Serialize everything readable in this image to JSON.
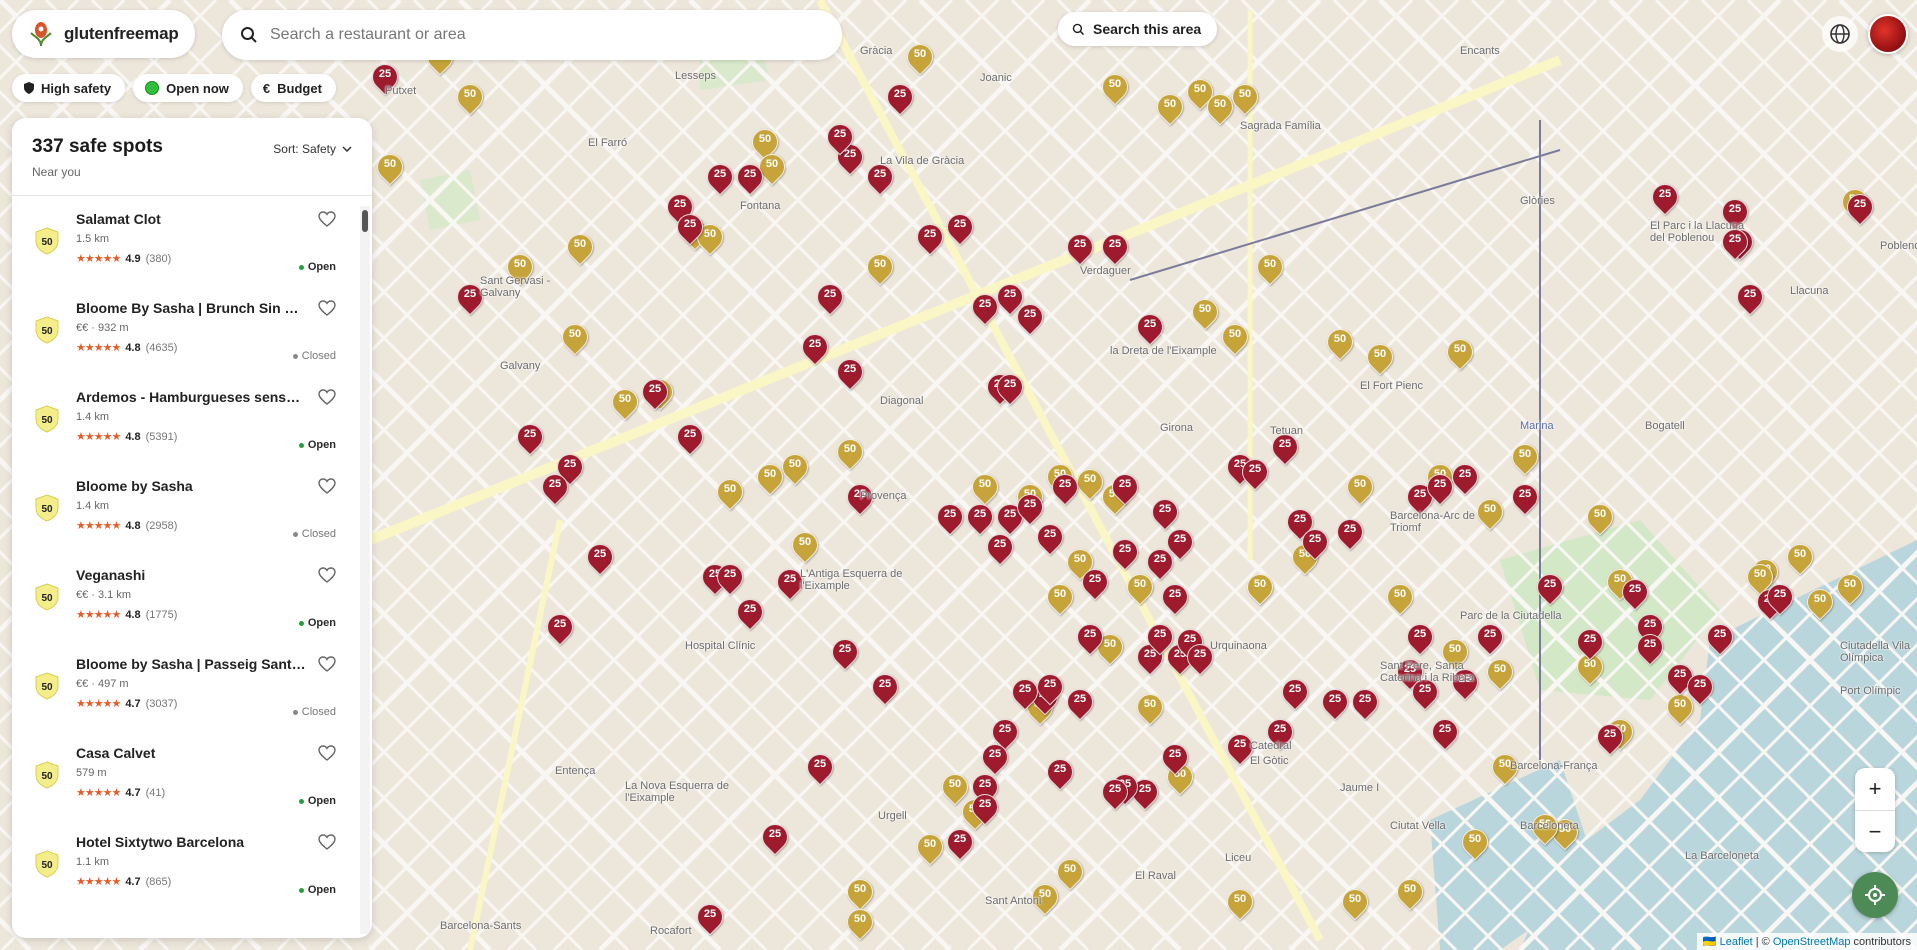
{
  "brand": {
    "name": "glutenfreemap"
  },
  "search": {
    "placeholder": "Search a restaurant or area"
  },
  "search_area": {
    "label": "Search this area"
  },
  "chips": [
    {
      "label": "High safety",
      "icon": "shield-icon"
    },
    {
      "label": "Open now",
      "icon": "green-dot-icon"
    },
    {
      "label": "Budget",
      "icon": "euro-icon",
      "prefix": "€"
    }
  ],
  "panel": {
    "title": "337 safe spots",
    "subtitle": "Near you",
    "sort_label": "Sort: Safety"
  },
  "restaurants": [
    {
      "badge": "50",
      "name": "Salamat Clot",
      "meta": "1.5 km",
      "rating": "4.9",
      "count": "(380)",
      "status": "Open"
    },
    {
      "badge": "50",
      "name": "Bloome By Sasha | Brunch Sin Gluten",
      "meta": "€€ · 932 m",
      "rating": "4.8",
      "count": "(4635)",
      "status": "Closed"
    },
    {
      "badge": "50",
      "name": "Ardemos - Hamburgueses sense gluten",
      "meta": "1.4 km",
      "rating": "4.8",
      "count": "(5391)",
      "status": "Open"
    },
    {
      "badge": "50",
      "name": "Bloome by Sasha",
      "meta": "1.4 km",
      "rating": "4.8",
      "count": "(2958)",
      "status": "Closed"
    },
    {
      "badge": "50",
      "name": "Veganashi",
      "meta": "€€ · 3.1 km",
      "rating": "4.8",
      "count": "(1775)",
      "status": "Open"
    },
    {
      "badge": "50",
      "name": "Bloome by Sasha | Passeig Sant Joan",
      "meta": "€€ · 497 m",
      "rating": "4.7",
      "count": "(3037)",
      "status": "Closed"
    },
    {
      "badge": "50",
      "name": "Casa Calvet",
      "meta": "579 m",
      "rating": "4.7",
      "count": "(41)",
      "status": "Open"
    },
    {
      "badge": "50",
      "name": "Hotel Sixtytwo Barcelona",
      "meta": "1.1 km",
      "rating": "4.7",
      "count": "(865)",
      "status": "Open"
    }
  ],
  "stars": "★★★★★",
  "map": {
    "labels": [
      "Gràcia",
      "La Vila de Gràcia",
      "Diagonal",
      "Provença",
      "Girona",
      "Verdaguer",
      "la Dreta de l'Eixample",
      "Tetuan",
      "El Fort Pienc",
      "Barcelona-Arc de Triomf",
      "Parc de la Ciutadella",
      "Urquinaona",
      "Sant Pere, Santa Caterina i la Ribera",
      "Barcelona-França",
      "Ciutat Vella",
      "El Raval",
      "Liceu",
      "Sant Antoni",
      "Urgell",
      "Rocafort",
      "Entença",
      "La Nova Esquerra de l'Eixample",
      "Hospital Clínic",
      "L'Antiga Esquerra de l'Eixample",
      "Sagrada Família",
      "Encants",
      "Glòries",
      "El Parc i la Llacuna del Poblenou",
      "Llacuna",
      "Bogatell",
      "Marina",
      "Ciutadella Vila Olímpica",
      "Port Olímpic",
      "La Barceloneta",
      "Barcelona-Sants",
      "Sant Gervasi - Galvany",
      "Galvany",
      "Joanic",
      "Fontana",
      "Lesseps",
      "Putxet",
      "El Farró",
      "Catedral",
      "El Gòtic",
      "Jaume I",
      "Barceloneta",
      "Poblenou"
    ],
    "gold_label": "50",
    "red_label": "25"
  },
  "zoom": {
    "in": "+",
    "out": "−"
  },
  "attribution": {
    "leaflet": "Leaflet",
    "sep": " | © ",
    "osm": "OpenStreetMap",
    "tail": " contributors",
    "flag": "🇺🇦"
  },
  "colors": {
    "gold_pin": "#c6a43a",
    "red_pin": "#9e1b2e",
    "open": "#22a13a",
    "star": "#e35d2a",
    "locate": "#4e8a56"
  }
}
